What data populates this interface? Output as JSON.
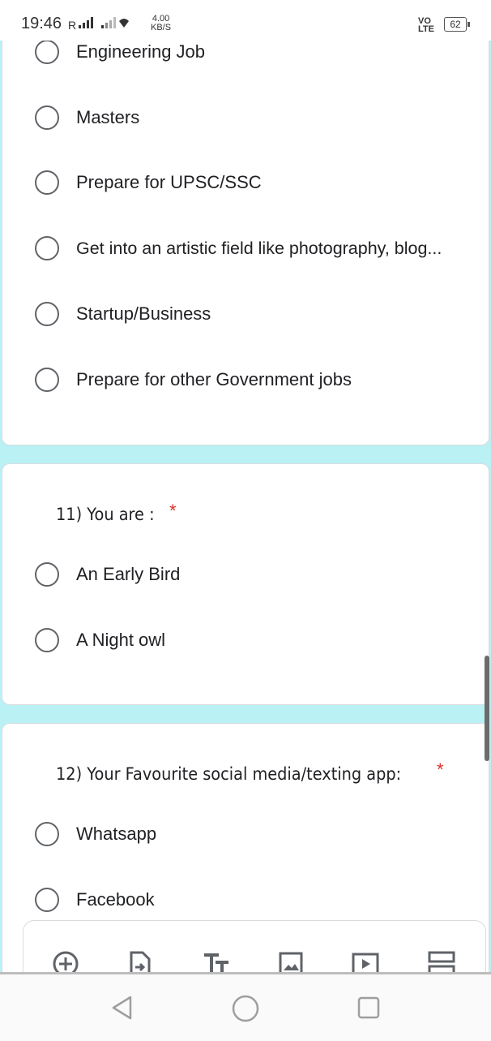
{
  "status_bar": {
    "time": "19:46",
    "signal": "R",
    "net_speed_value": "4.00",
    "net_speed_unit": "KB/S",
    "volte_top": "VO",
    "volte_bottom": "LTE",
    "battery": "62"
  },
  "question_10": {
    "options": [
      "Engineering Job",
      "Masters",
      "Prepare for UPSC/SSC",
      "Get into an artistic field like photography, blog...",
      "Startup/Business",
      "Prepare for other Government jobs"
    ]
  },
  "question_11": {
    "title": "11) You are :",
    "required_mark": "*",
    "options": [
      "An Early Bird",
      "A Night owl"
    ]
  },
  "question_12": {
    "title": "12) Your Favourite social media/texting app:",
    "required_mark": "*",
    "options": [
      "Whatsapp",
      "Facebook"
    ]
  },
  "toolbar": {
    "icons": [
      "add-question-icon",
      "import-questions-icon",
      "add-title-icon",
      "add-image-icon",
      "add-video-icon",
      "add-section-icon"
    ]
  },
  "colors": {
    "background": "#b9f1f4",
    "required": "#d93025",
    "radio_border": "#5f6368"
  }
}
